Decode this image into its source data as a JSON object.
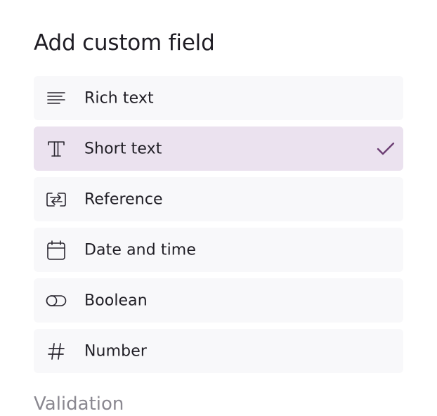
{
  "title": "Add custom field",
  "options": [
    {
      "label": "Rich text",
      "icon": "align-left-icon",
      "selected": false
    },
    {
      "label": "Short text",
      "icon": "text-type-icon",
      "selected": true
    },
    {
      "label": "Reference",
      "icon": "reference-icon",
      "selected": false
    },
    {
      "label": "Date and time",
      "icon": "calendar-icon",
      "selected": false
    },
    {
      "label": "Boolean",
      "icon": "toggle-icon",
      "selected": false
    },
    {
      "label": "Number",
      "icon": "hash-icon",
      "selected": false
    }
  ],
  "validation_label": "Validation",
  "colors": {
    "selected_bg": "#ebe2ef",
    "option_bg": "#f8f8fa",
    "check": "#6b3d73",
    "muted_text": "#8a8890"
  }
}
